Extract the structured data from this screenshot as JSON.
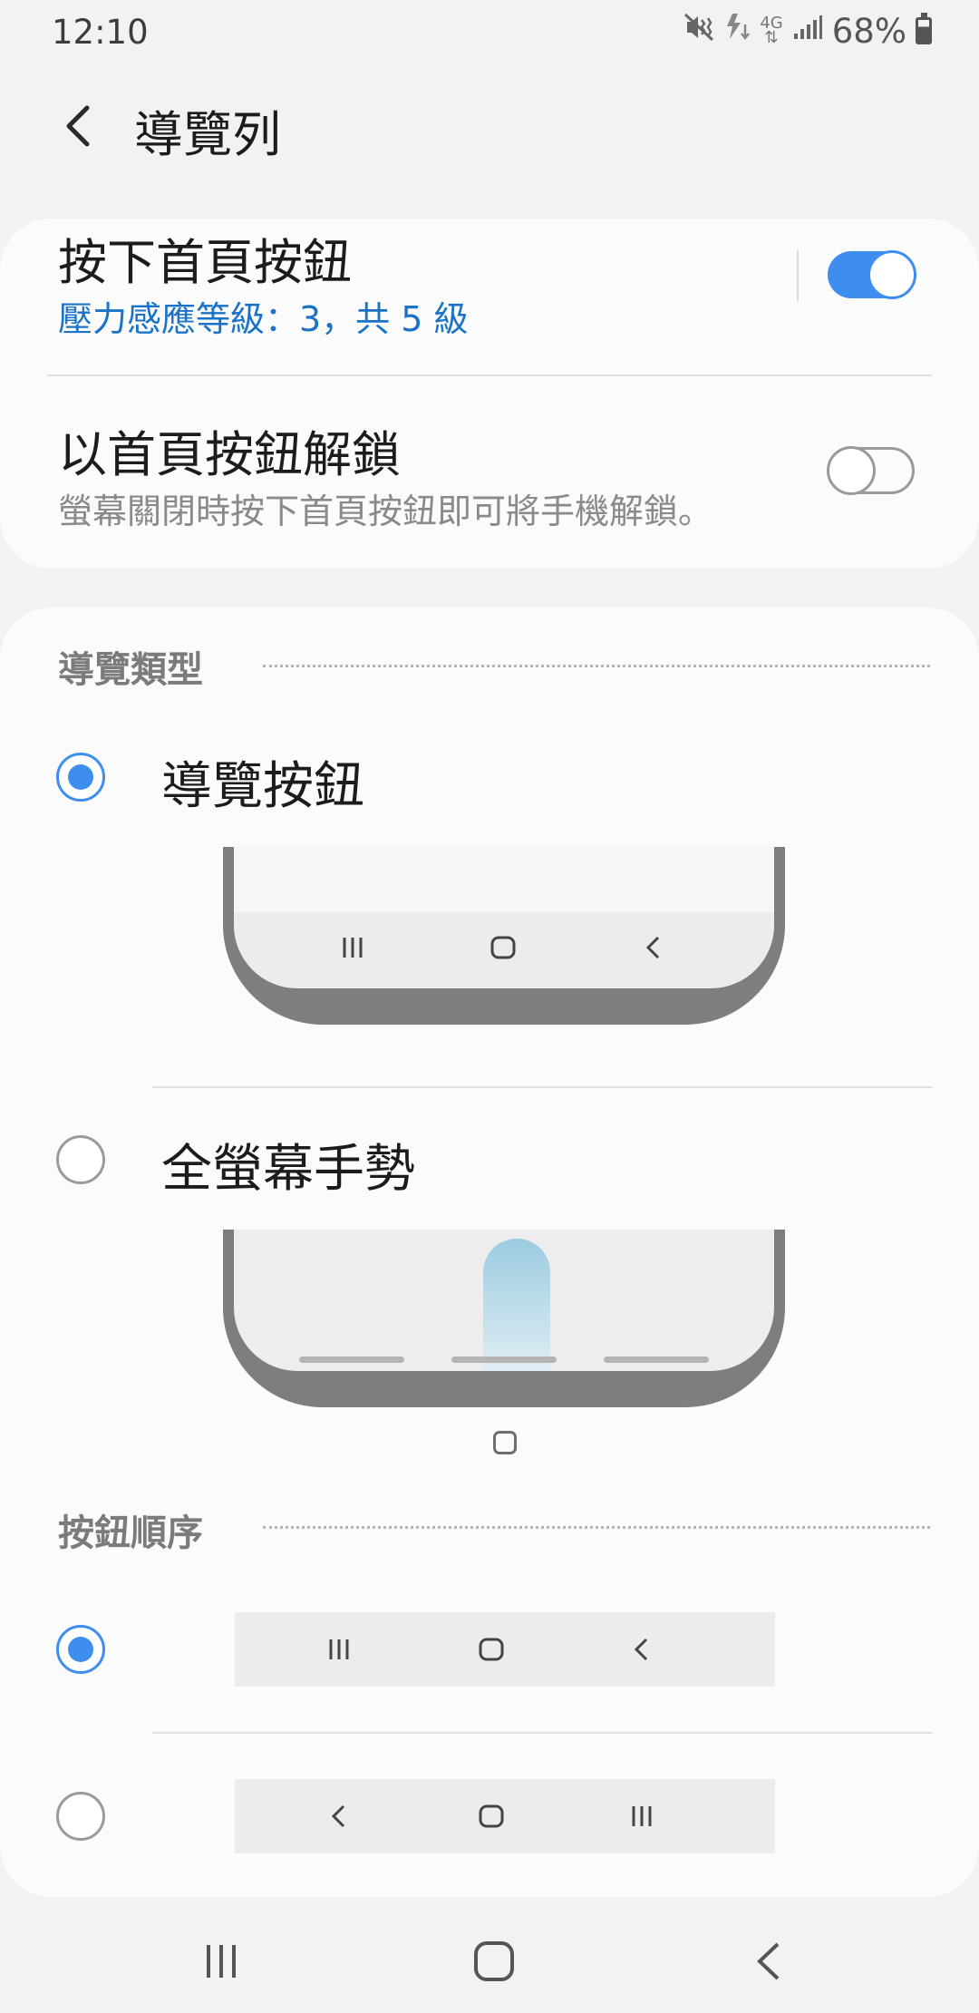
{
  "status_bar": {
    "time": "12:10",
    "network_label": "4G",
    "battery_percent": "68%",
    "icons": [
      "mute-vibrate-icon",
      "data-activity-icon",
      "network-4g-icon",
      "signal-icon",
      "battery-icon"
    ]
  },
  "header": {
    "back_icon": "chevron-left-icon",
    "title": "導覽列"
  },
  "home_button_section": {
    "press_home": {
      "title": "按下首頁按鈕",
      "subtitle": "壓力感應等級：3，共 5 級",
      "toggle_on": true
    },
    "unlock_home": {
      "title": "以首頁按鈕解鎖",
      "subtitle": "螢幕關閉時按下首頁按鈕即可將手機解鎖。",
      "toggle_on": false
    }
  },
  "nav_type": {
    "header": "導覽類型",
    "options": [
      {
        "label": "導覽按鈕",
        "selected": true
      },
      {
        "label": "全螢幕手勢",
        "selected": false
      }
    ]
  },
  "button_order": {
    "header": "按鈕順序",
    "options": [
      {
        "order": [
          "recents-icon",
          "home-icon",
          "back-icon"
        ],
        "selected": true
      },
      {
        "order": [
          "back-icon",
          "home-icon",
          "recents-icon"
        ],
        "selected": false
      }
    ]
  },
  "system_nav": {
    "buttons": [
      "recents-icon",
      "home-icon",
      "back-icon"
    ]
  },
  "colors": {
    "accent": "#3e8ef0",
    "subtitle_blue": "#1a73c6",
    "background": "#f2f2f2",
    "card": "#fbfbfb"
  }
}
